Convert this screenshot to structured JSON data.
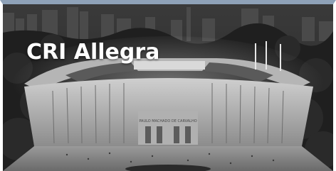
{
  "card": {
    "title": "CRI Allegra",
    "image_description": "grayscale aerial rendering of stadium in city at night",
    "accent_color": "#8fa2b8"
  },
  "photo": {
    "stadium_signage": "PAULO MACHADO DE CARVALHO"
  }
}
